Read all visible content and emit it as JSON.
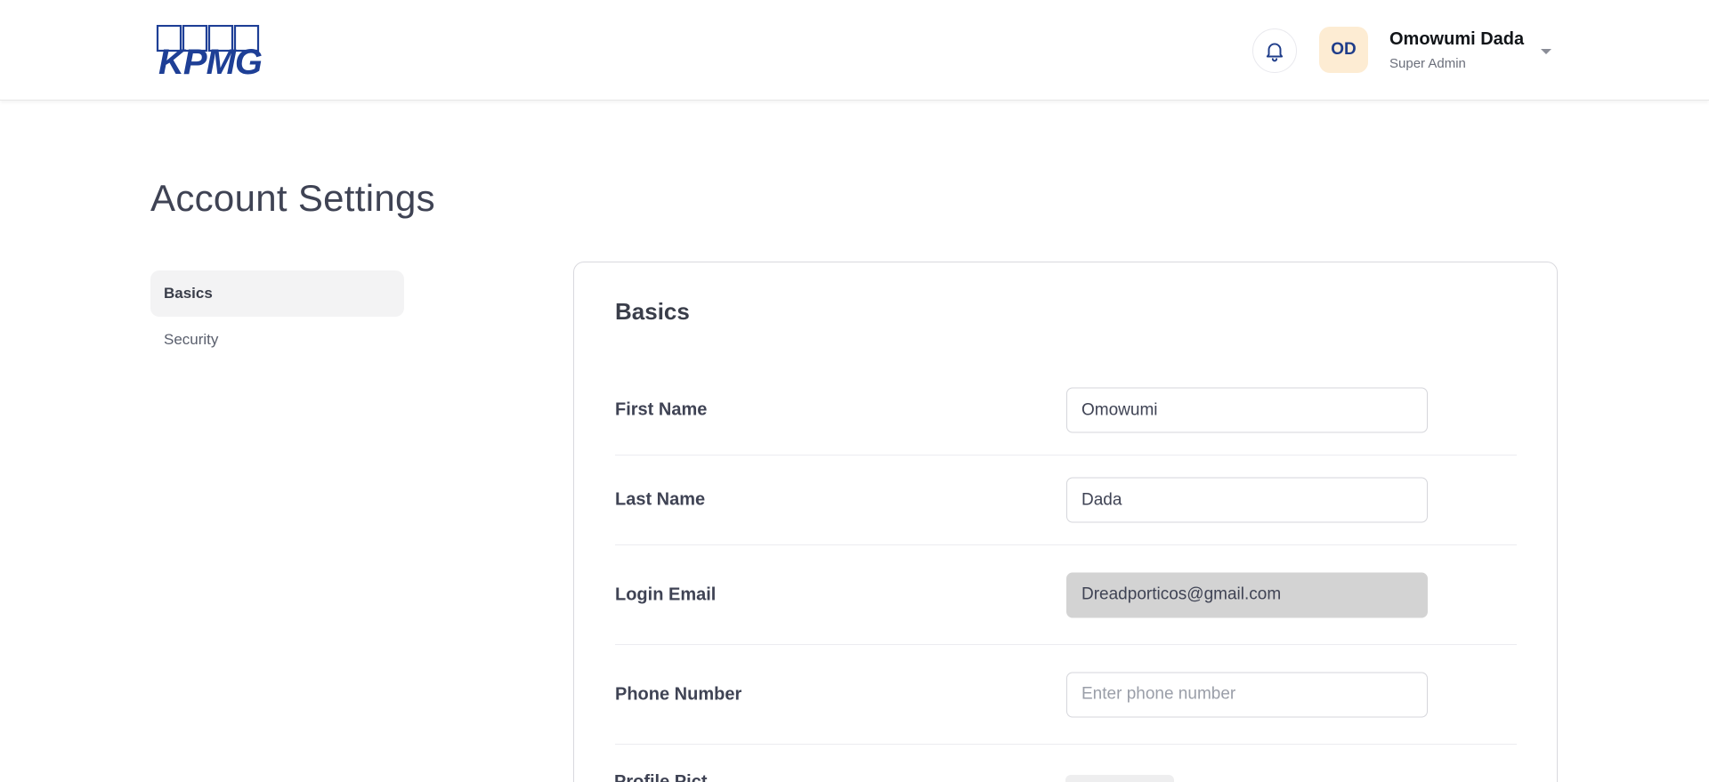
{
  "brand": {
    "logo_text": "KPMG",
    "color": "#1e3f96"
  },
  "header": {
    "notifications_icon": "bell-icon",
    "avatar_initials": "OD",
    "user_name": "Omowumi Dada",
    "user_role": "Super Admin",
    "menu_icon": "caret-down-icon"
  },
  "page": {
    "title": "Account Settings"
  },
  "sidebar": {
    "items": [
      {
        "label": "Basics",
        "active": true
      },
      {
        "label": "Security",
        "active": false
      }
    ]
  },
  "basics": {
    "title": "Basics",
    "fields": [
      {
        "label": "First Name",
        "value": "Omowumi",
        "placeholder": ""
      },
      {
        "label": "Last Name",
        "value": "Dada",
        "placeholder": ""
      },
      {
        "label": "Login Email",
        "value": "Dreadporticos@gmail.com",
        "placeholder": "",
        "disabled": true
      },
      {
        "label": "Phone Number",
        "value": "",
        "placeholder": "Enter phone number"
      }
    ],
    "next_label_partial": "Profile Pict"
  }
}
